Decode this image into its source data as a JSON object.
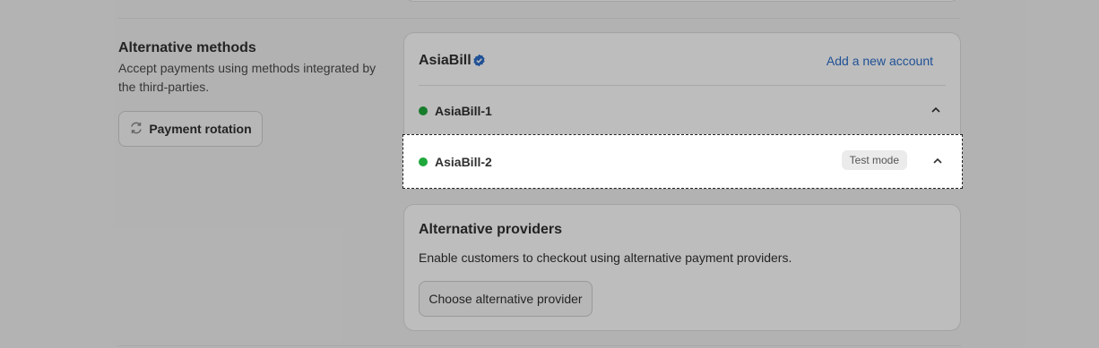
{
  "sidebar": {
    "title": "Alternative methods",
    "description": "Accept payments using methods integrated by the third-parties.",
    "rotation_button": "Payment rotation"
  },
  "provider_card": {
    "name": "AsiaBill",
    "add_account_link": "Add a new account",
    "accounts": [
      {
        "name": "AsiaBill-1",
        "status_color": "#1fa83c"
      },
      {
        "name": "AsiaBill-2",
        "status_color": "#1fa83c",
        "badge": "Test mode"
      }
    ]
  },
  "alt_providers": {
    "title": "Alternative providers",
    "description": "Enable customers to checkout using alternative payment providers.",
    "button": "Choose alternative provider"
  },
  "colors": {
    "link": "#2c6ecb",
    "status_active": "#1fa83c",
    "verified": "#2c6ecb"
  },
  "icons": [
    "rotation-icon",
    "verified-badge-icon",
    "chevron-up-icon"
  ]
}
